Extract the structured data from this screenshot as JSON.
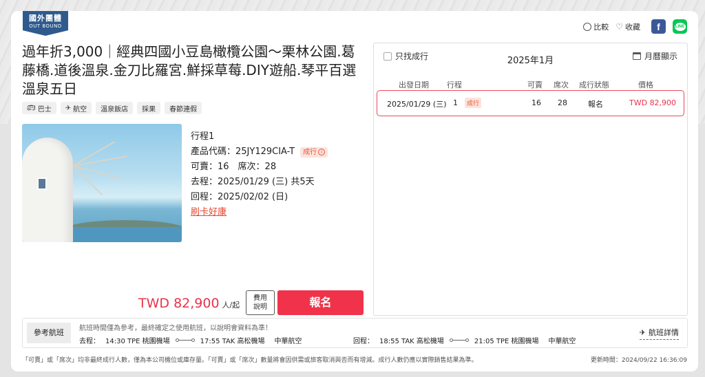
{
  "badge": {
    "line1": "國外團體",
    "line2": "OUT BOUND"
  },
  "actions": {
    "compare": "比較",
    "favorite": "收藏",
    "facebook": "f",
    "line": "LINE"
  },
  "product": {
    "title": "過年折3,000｜經典四國小豆島橄欖公園～栗林公園.葛藤橋.道後溫泉.金刀比羅宮.鮮採草莓.DIY遊船.琴平百選溫泉五日",
    "tags": [
      {
        "label": "巴士",
        "icon": "bus-icon"
      },
      {
        "label": "航空",
        "icon": "airplane-icon"
      },
      {
        "label": "溫泉飯店",
        "icon": ""
      },
      {
        "label": "採果",
        "icon": ""
      },
      {
        "label": "春節連假",
        "icon": ""
      }
    ],
    "itinerary": "行程1",
    "code_label": "產品代碼：",
    "code": "25JY129CIA-T",
    "status": "成行",
    "availability": "可賣：16　席次：28",
    "depart": "去程：2025/01/29 (三)  共5天",
    "return": "回程：2025/02/02 (日)",
    "promo_link": "刷卡好康",
    "price": "TWD 82,900",
    "price_unit": "人/起",
    "fee_button": "費用說明",
    "fee_line1": "費用",
    "fee_line2": "說明",
    "book_button": "報名"
  },
  "panel": {
    "only_confirmed": "只找成行",
    "month": "2025年1月",
    "calendar_view": "月曆顯示",
    "headers": {
      "date": "出發日期",
      "itin": "行程",
      "avail": "可賣",
      "seats": "席次",
      "status": "成行狀態",
      "price": "價格"
    },
    "row": {
      "date": "2025/01/29 (三)",
      "itin": "1",
      "status": "成行",
      "avail": "16",
      "seats": "28",
      "action": "報名",
      "price": "TWD  82,900"
    }
  },
  "flight": {
    "ref_button": "參考航班",
    "note": "航班時間僅為參考，最終確定之使用航班，以說明會資料為準！",
    "outbound_label": "去程：",
    "outbound_dep": "14:30 TPE 桃園機場",
    "outbound_arr": "17:55 TAK 高松機場",
    "outbound_airline": "中華航空",
    "return_label": "回程：",
    "return_dep": "18:55 TAK 高松機場",
    "return_arr": "21:05 TPE 桃園機場",
    "return_airline": "中華航空",
    "detail_link": "航班詳情"
  },
  "footer": {
    "note": "「可賣」或「席次」均非最終成行人數，僅為本公司機位或庫存量。「可賣」或「席次」數量將會因供需或旅客取消與否而有增減。成行人數仍應以實際銷售結果為準。",
    "updated": "更新時間：2024/09/22 16:36:09"
  }
}
